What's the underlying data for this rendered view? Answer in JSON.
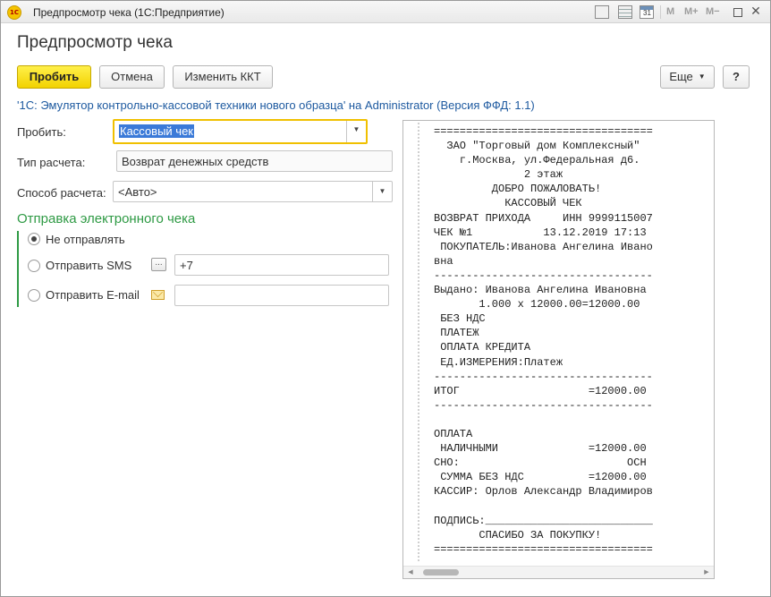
{
  "window": {
    "title": "Предпросмотр чека  (1С:Предприятие)",
    "logo_text": "1С",
    "controls": {
      "m": "M",
      "m_plus": "M+",
      "m_minus": "M−",
      "close": "✕"
    },
    "calendar_day": "31"
  },
  "form": {
    "title": "Предпросмотр чека",
    "buttons": {
      "punch": "Пробить",
      "cancel": "Отмена",
      "change_kkt": "Изменить ККТ",
      "more": "Еще",
      "help": "?"
    },
    "emulator_link": "'1С: Эмулятор контрольно-кассовой техники нового образца' на Administrator (Версия ФФД: 1.1)",
    "fields": {
      "punch_label": "Пробить:",
      "punch_value": "Кассовый чек",
      "payment_type_label": "Тип расчета:",
      "payment_type_value": "Возврат денежных средств",
      "payment_method_label": "Способ расчета:",
      "payment_method_value": "<Авто>"
    },
    "electronic": {
      "title": "Отправка электронного чека",
      "options": [
        {
          "label": "Не отправлять",
          "checked": true
        },
        {
          "label": "Отправить SMS",
          "checked": false
        },
        {
          "label": "Отправить E-mail",
          "checked": false
        }
      ],
      "sms_value": "+7",
      "email_value": ""
    }
  },
  "receipt": {
    "lines": [
      "==================================",
      "  ЗАО \"Торговый дом Комплексный\"",
      "    г.Москва, ул.Федеральная д6.",
      "              2 этаж",
      "         ДОБРО ПОЖАЛОВАТЬ!",
      "           КАССОВЫЙ ЧЕК",
      "ВОЗВРАТ ПРИХОДА     ИНН 9999115007",
      "ЧЕК №1           13.12.2019 17:13",
      " ПОКУПАТЕЛЬ:Иванова Ангелина Ивано",
      "вна",
      "----------------------------------",
      "Выдано: Иванова Ангелина Ивановна",
      "       1.000 x 12000.00=12000.00",
      " БЕЗ НДС",
      " ПЛАТЕЖ",
      " ОПЛАТА КРЕДИТА",
      " ЕД.ИЗМЕРЕНИЯ:Платеж",
      "----------------------------------",
      "ИТОГ                    =12000.00",
      "----------------------------------",
      "",
      "ОПЛАТА",
      " НАЛИЧНЫМИ              =12000.00",
      "СНО:                          ОСН",
      " СУММА БЕЗ НДС          =12000.00",
      "КАССИР: Орлов Александр Владимиров",
      "",
      "ПОДПИСЬ:__________________________",
      "       СПАСИБО ЗА ПОКУПКУ!",
      "=================================="
    ]
  }
}
